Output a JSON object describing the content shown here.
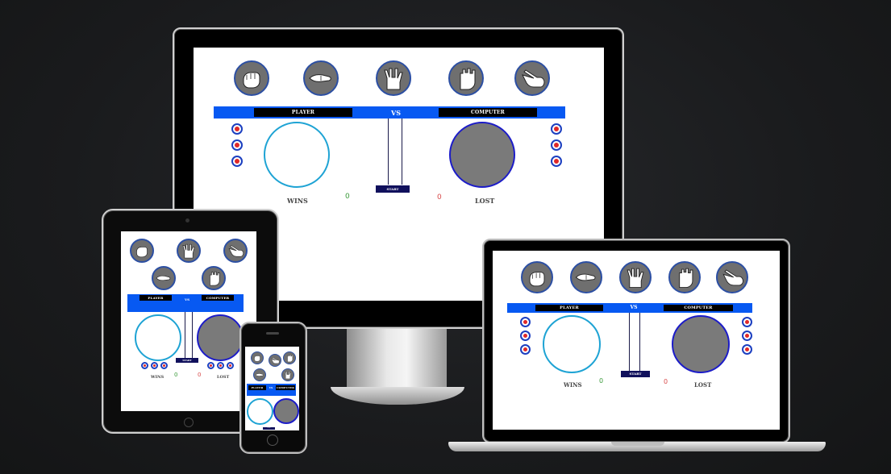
{
  "game": {
    "player_label": "PLAYER",
    "vs_label": "VS",
    "computer_label": "COMPUTER",
    "start_label": "START",
    "wins_label": "WINS",
    "lost_label": "LOST",
    "wins_score": "0",
    "lost_score": "0",
    "lives": 3,
    "choices": [
      "rock-icon",
      "lizard-icon",
      "spock-icon",
      "paper-icon",
      "scissors-icon"
    ]
  },
  "colors": {
    "accent_bar": "#0759f2",
    "label_bg": "#000000",
    "start_bg": "#10105c",
    "player_ring": "#1ea3d4",
    "computer_ring": "#1c1cc8",
    "wins_color": "#3a9a3a",
    "lost_color": "#d84a4a"
  }
}
